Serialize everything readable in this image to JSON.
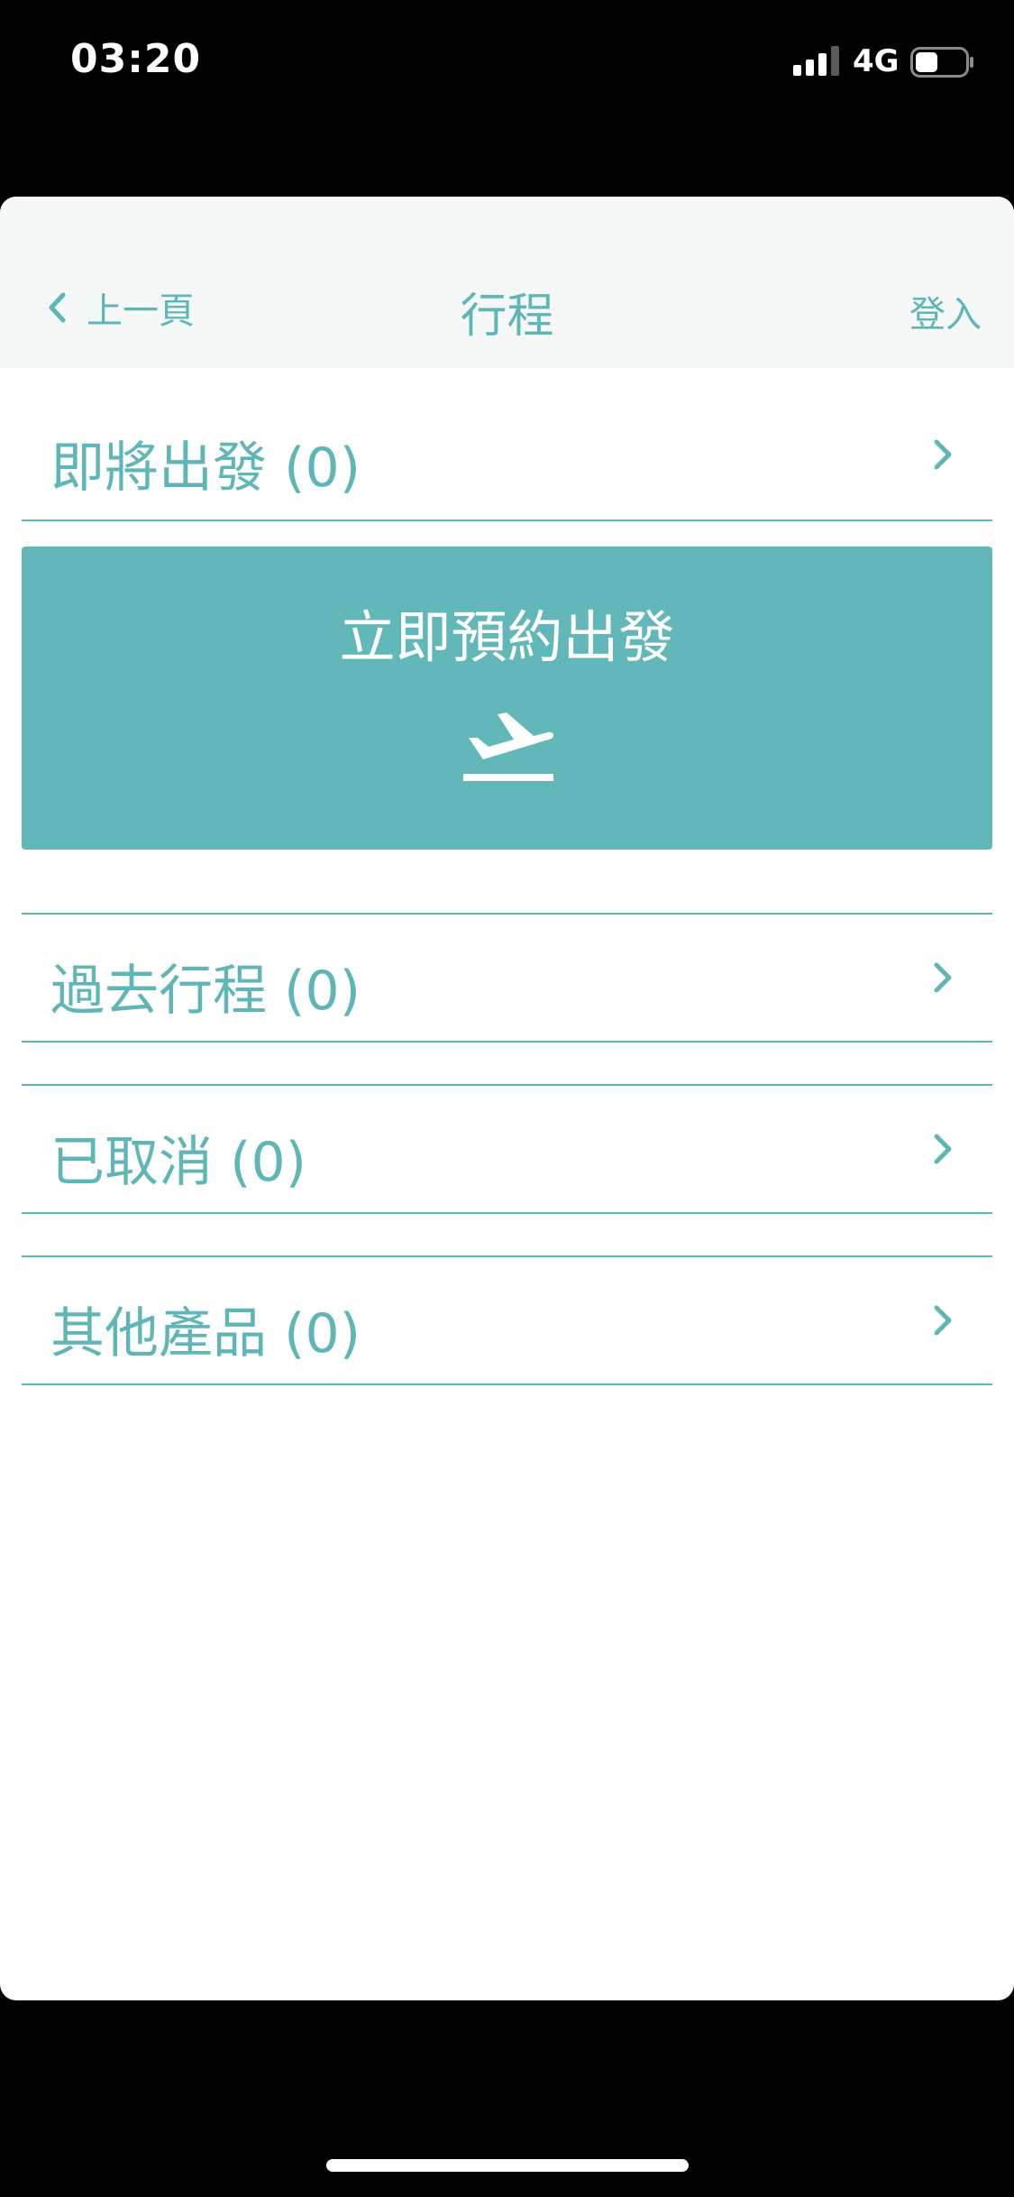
{
  "status_bar": {
    "time": "03:20",
    "network": "4G",
    "battery_level": 0.45
  },
  "nav": {
    "back_label": "上一頁",
    "title": "行程",
    "login_label": "登入"
  },
  "sections": {
    "upcoming": "即將出發 (0)",
    "past": "過去行程 (0)",
    "cancelled": "已取消 (0)",
    "other": "其他產品 (0)"
  },
  "book_card": {
    "label": "立即預約出發",
    "icon": "airplane-takeoff-icon"
  },
  "colors": {
    "accent": "#5fb6b7",
    "card": "#62b8b9",
    "nav_background": "#f6f8f8",
    "page_background": "#ffffff",
    "frame": "#000000"
  }
}
